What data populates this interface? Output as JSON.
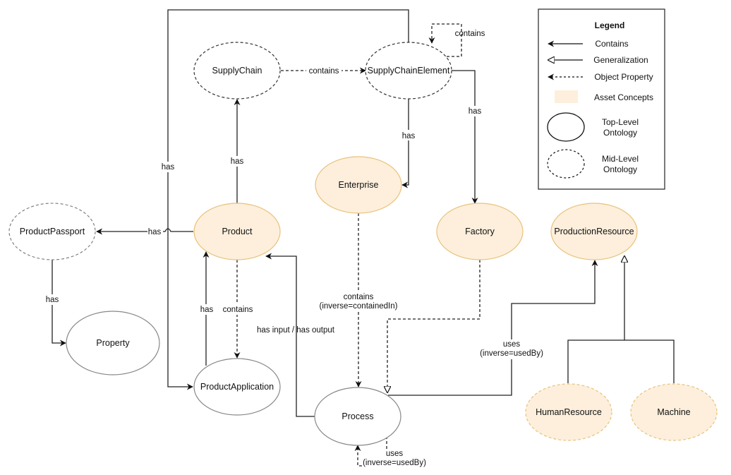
{
  "colors": {
    "asset_fill": "#fdefdc",
    "asset_stroke": "#e8c27a",
    "line": "#222222",
    "top_level_stroke": "#888888",
    "mid_level_stroke": "#444444"
  },
  "nodes": {
    "supply_chain": {
      "label": "SupplyChain",
      "kind": "mid-level"
    },
    "supply_chain_element": {
      "label": "SupplyChainElement",
      "kind": "mid-level"
    },
    "enterprise": {
      "label": "Enterprise",
      "kind": "asset"
    },
    "factory": {
      "label": "Factory",
      "kind": "asset"
    },
    "production_resource": {
      "label": "ProductionResource",
      "kind": "asset"
    },
    "product_passport": {
      "label": "ProductPassport",
      "kind": "mid-level"
    },
    "product": {
      "label": "Product",
      "kind": "asset"
    },
    "property": {
      "label": "Property",
      "kind": "top-level"
    },
    "product_application": {
      "label": "ProductApplication",
      "kind": "top-level"
    },
    "process": {
      "label": "Process",
      "kind": "top-level"
    },
    "human_resource": {
      "label": "HumanResource",
      "kind": "asset-mid-level"
    },
    "machine": {
      "label": "Machine",
      "kind": "asset-mid-level"
    }
  },
  "edges": {
    "sc_contains_sce": {
      "label": "contains",
      "from": "SupplyChain",
      "to": "SupplyChainElement",
      "type": "object-property"
    },
    "sce_contains_self": {
      "label": "contains",
      "from": "SupplyChainElement",
      "to": "SupplyChainElement",
      "type": "object-property"
    },
    "sce_has_enterprise": {
      "label": "has",
      "from": "SupplyChainElement",
      "to": "Enterprise",
      "type": "contains"
    },
    "sce_has_factory": {
      "label": "has",
      "from": "SupplyChainElement",
      "to": "Factory",
      "type": "contains"
    },
    "product_has_sc": {
      "label": "has",
      "from": "Product",
      "to": "SupplyChain",
      "type": "contains"
    },
    "sce_has_pa": {
      "label": "has",
      "from": "SupplyChainElement",
      "to": "ProductApplication",
      "type": "contains"
    },
    "product_has_passport": {
      "label": "has",
      "from": "Product",
      "to": "ProductPassport",
      "type": "contains"
    },
    "passport_has_property": {
      "label": "has",
      "from": "ProductPassport",
      "to": "Property",
      "type": "contains"
    },
    "pa_has_product": {
      "label": "has",
      "from": "ProductApplication",
      "to": "Product",
      "type": "contains"
    },
    "product_contains_pa": {
      "label": "contains",
      "from": "Product",
      "to": "ProductApplication",
      "type": "object-property"
    },
    "process_io_product": {
      "label": "has input / has output",
      "from": "Process",
      "to": "Product",
      "type": "contains"
    },
    "enterprise_contains_process": {
      "label": "contains",
      "label2": "(inverse=containedIn)",
      "from": "Enterprise",
      "to": "Process",
      "type": "object-property"
    },
    "factory_gen_process": {
      "from": "Factory",
      "to": "Process",
      "type": "dashed-generalization"
    },
    "process_uses_pr": {
      "label": "uses",
      "label2": "(inverse=usedBy)",
      "from": "Process",
      "to": "ProductionResource",
      "type": "contains"
    },
    "process_uses_self": {
      "label": "uses",
      "label2": "(inverse=usedBy)",
      "from": "Process",
      "to": "Process",
      "type": "object-property"
    },
    "hr_gen_pr": {
      "from": "HumanResource",
      "to": "ProductionResource",
      "type": "generalization"
    },
    "machine_gen_pr": {
      "from": "Machine",
      "to": "ProductionResource",
      "type": "generalization"
    }
  },
  "legend": {
    "title": "Legend",
    "items": [
      {
        "label": "Contains",
        "symbol": "solid-arrow"
      },
      {
        "label": "Generalization",
        "symbol": "hollow-arrow"
      },
      {
        "label": "Object Property",
        "symbol": "dashed-arrow"
      },
      {
        "label": "Asset Concepts",
        "symbol": "filled-rect"
      },
      {
        "label": "Top-Level",
        "label2": "Ontology",
        "symbol": "solid-ellipse"
      },
      {
        "label": "Mid-Level",
        "label2": "Ontology",
        "symbol": "dashed-ellipse"
      }
    ]
  }
}
